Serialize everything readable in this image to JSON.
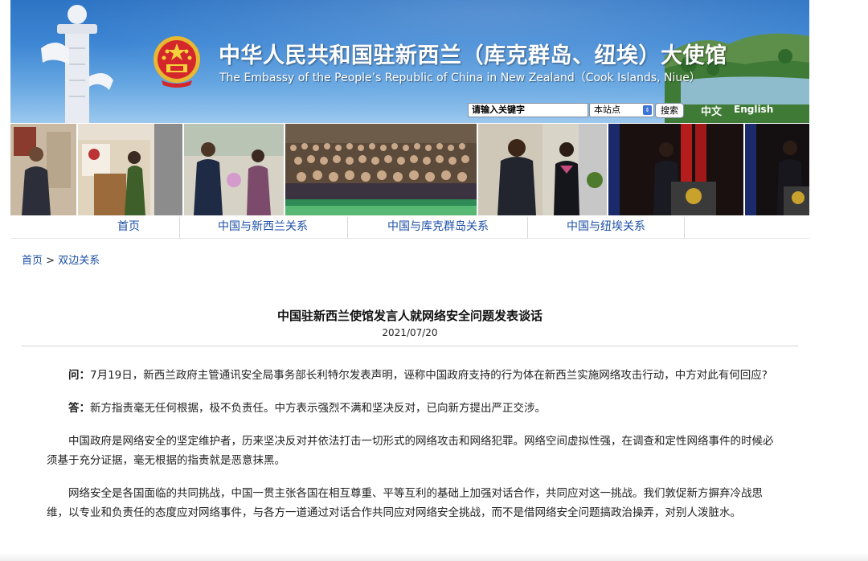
{
  "header": {
    "title_cn": "中华人民共和国驻新西兰（库克群岛、纽埃）大使馆",
    "title_en": "The Embassy of the People’s Republic of China in New Zealand（Cook Islands, Niue）",
    "search": {
      "placeholder": "请输入关键字",
      "value": "请输入关键字"
    },
    "scope_select": "本站点",
    "search_button": "搜索",
    "lang_cn": "中文",
    "lang_en": "English",
    "icons": [
      "national-emblem-icon",
      "huabiao-pillar-icon",
      "chevron-updown-icon"
    ],
    "colors": {
      "banner_blue": "#3d86d4",
      "link_blue": "#1c4fa6"
    }
  },
  "nav": {
    "items": [
      {
        "label": "首页"
      },
      {
        "label": "中国与新西兰关系"
      },
      {
        "label": "中国与库克群岛关系"
      },
      {
        "label": "中国与纽埃关系"
      }
    ]
  },
  "breadcrumb": {
    "home": "首页",
    "sep": " > ",
    "current": "双边关系"
  },
  "article": {
    "title": "中国驻新西兰使馆发言人就网络安全问题发表谈话",
    "date": "2021/07/20",
    "paragraphs": [
      {
        "lead": "问：",
        "text": "7月19日，新西兰政府主管通讯安全局事务部长利特尔发表声明，诬称中国政府支持的行为体在新西兰实施网络攻击行动，中方对此有何回应?"
      },
      {
        "lead": "答：",
        "text": "新方指责毫无任何根据，极不负责任。中方表示强烈不满和坚决反对，已向新方提出严正交涉。"
      },
      {
        "lead": "",
        "text": "中国政府是网络安全的坚定维护者，历来坚决反对并依法打击一切形式的网络攻击和网络犯罪。网络空间虚拟性强，在调查和定性网络事件的时候必须基于充分证据，毫无根据的指责就是恶意抹黑。"
      },
      {
        "lead": "",
        "text": "网络安全是各国面临的共同挑战，中国一贯主张各国在相互尊重、平等互利的基础上加强对话合作，共同应对这一挑战。我们敦促新方摒弃冷战思维，以专业和负责任的态度应对网络事件，与各方一道通过对话合作共同应对网络安全挑战，而不是借网络安全问题搞政治操弄，对别人泼脏水。"
      }
    ]
  }
}
